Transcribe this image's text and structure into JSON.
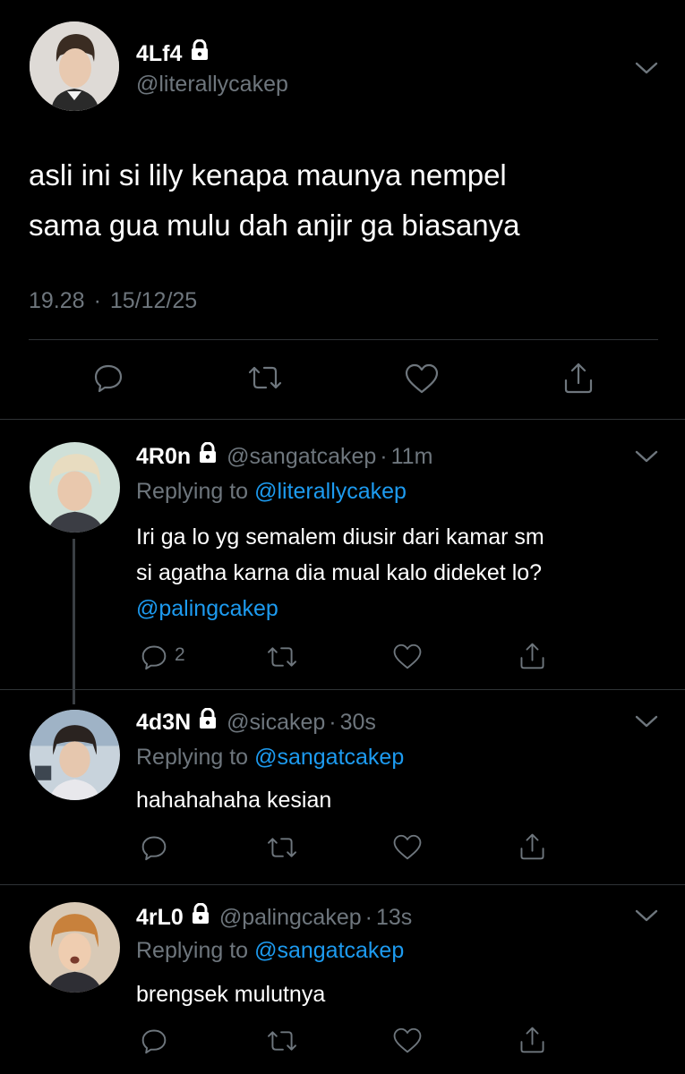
{
  "main_tweet": {
    "display_name": "4Lf4",
    "handle": "@literallycakep",
    "text_line1": "asli ini si lily kenapa maunya nempel",
    "text_line2": "sama gua mulu dah anjir ga biasanya",
    "time": "19.28",
    "separator": "·",
    "date": "15/12/25"
  },
  "replies": [
    {
      "display_name": "4R0n",
      "handle": "@sangatcakep",
      "separator": "·",
      "age": "11m",
      "replying_prefix": "Replying to",
      "replying_to": "@literallycakep",
      "text_line1": "Iri ga lo yg semalem diusir dari kamar sm",
      "text_line2": "si agatha karna dia mual kalo dideket lo?",
      "mention": "@palingcakep",
      "reply_count": "2"
    },
    {
      "display_name": "4d3N",
      "handle": "@sicakep",
      "separator": "·",
      "age": "30s",
      "replying_prefix": "Replying to",
      "replying_to": "@sangatcakep",
      "text_line1": "hahahahaha kesian"
    },
    {
      "display_name": "4rL0",
      "handle": "@palingcakep",
      "separator": "·",
      "age": "13s",
      "replying_prefix": "Replying to",
      "replying_to": "@sangatcakep",
      "text_line1": "brengsek mulutnya"
    }
  ],
  "colors": {
    "background": "#000000",
    "text": "#ffffff",
    "muted": "#6e767d",
    "link": "#1d9bf0",
    "divider": "#2f3336"
  }
}
